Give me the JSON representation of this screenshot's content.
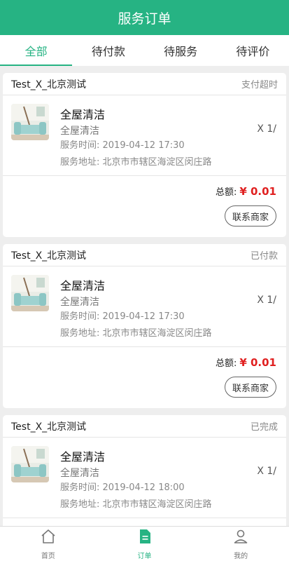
{
  "header": {
    "title": "服务订单"
  },
  "tabs": [
    {
      "label": "全部",
      "active": true
    },
    {
      "label": "待付款",
      "active": false
    },
    {
      "label": "待服务",
      "active": false
    },
    {
      "label": "待评价",
      "active": false
    }
  ],
  "orders": [
    {
      "shop": "Test_X_北京测试",
      "status": "支付超时",
      "item_title": "全屋清洁",
      "item_sub": "全屋清洁",
      "time": "服务时间: 2019-04-12 17:30",
      "address": "服务地址: 北京市市辖区海淀区闵庄路",
      "qty": "X 1/",
      "total_label": "总额:",
      "total_amount": "¥ 0.01",
      "button": "联系商家"
    },
    {
      "shop": "Test_X_北京测试",
      "status": "已付款",
      "item_title": "全屋清洁",
      "item_sub": "全屋清洁",
      "time": "服务时间: 2019-04-12 17:30",
      "address": "服务地址: 北京市市辖区海淀区闵庄路",
      "qty": "X 1/",
      "total_label": "总额:",
      "total_amount": "¥ 0.01",
      "button": "联系商家"
    },
    {
      "shop": "Test_X_北京测试",
      "status": "已完成",
      "item_title": "全屋清洁",
      "item_sub": "全屋清洁",
      "time": "服务时间: 2019-04-12 18:00",
      "address": "服务地址: 北京市市辖区海淀区闵庄路",
      "qty": "X 1/"
    }
  ],
  "bottom_nav": [
    {
      "label": "首页",
      "icon": "home-icon",
      "active": false
    },
    {
      "label": "订单",
      "icon": "order-document-icon",
      "active": true
    },
    {
      "label": "我的",
      "icon": "user-profile-icon",
      "active": false
    }
  ],
  "colors": {
    "brand": "#26b383",
    "price": "#e02020"
  }
}
